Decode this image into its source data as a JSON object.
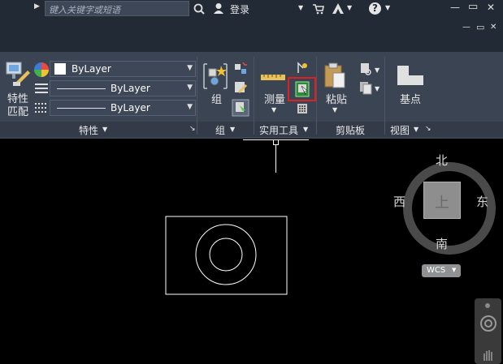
{
  "titlebar": {
    "search_placeholder": "键入关键字或短语",
    "login_label": "登录",
    "help_label": "?"
  },
  "window_controls": {
    "minimize": "—",
    "restore": "▭",
    "close": "✕"
  },
  "ribbon": {
    "properties": {
      "match_label_line1": "特性",
      "match_label_line2": "匹配",
      "color_value": "ByLayer",
      "linetype_value": "ByLayer",
      "lineweight_value": "ByLayer",
      "panel_title": "特性"
    },
    "group": {
      "label": "组",
      "panel_title": "组"
    },
    "utilities": {
      "measure_label": "测量",
      "panel_title": "实用工具"
    },
    "clipboard": {
      "paste_label": "粘贴",
      "panel_title": "剪贴板"
    },
    "view": {
      "basepoint_label": "基点",
      "panel_title": "视图"
    }
  },
  "viewcube": {
    "north": "北",
    "south": "南",
    "east": "东",
    "west": "西",
    "top": "上",
    "wcs_label": "WCS"
  },
  "colors": {
    "ribbon_bg": "#3b4453",
    "titlebar_bg": "#222a35",
    "highlight": "#e02020",
    "canvas_bg": "#000000"
  }
}
